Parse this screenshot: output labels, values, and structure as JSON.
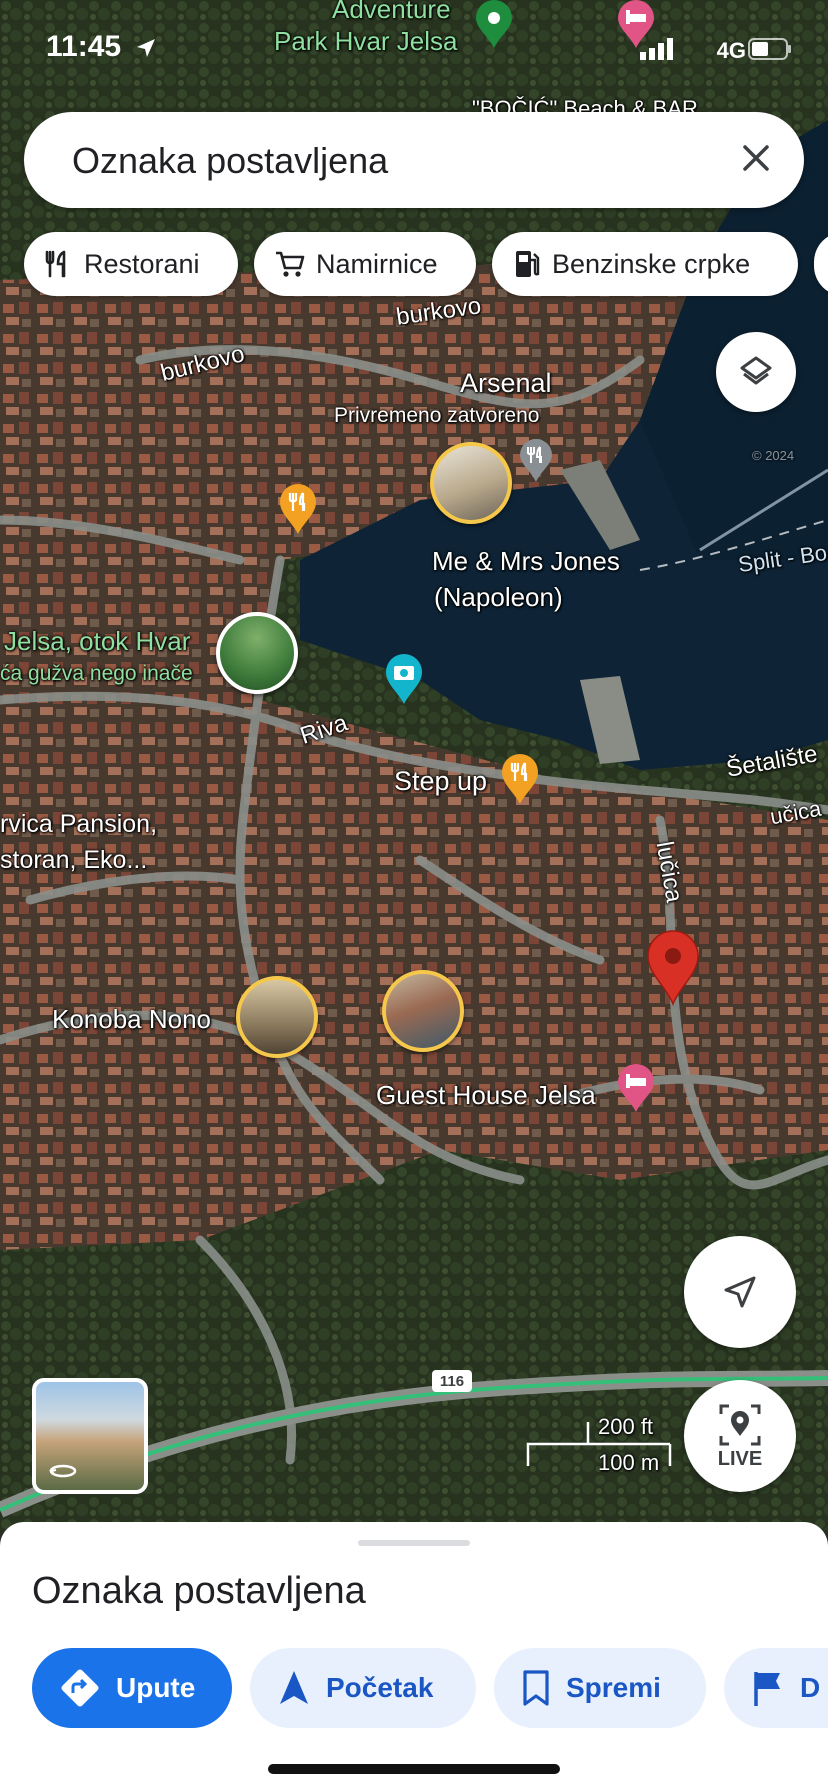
{
  "status_bar": {
    "time": "11:45",
    "network": "4G"
  },
  "search": {
    "query": "Oznaka postavljena"
  },
  "chips": [
    {
      "label": "Restorani",
      "icon": "restaurant-icon"
    },
    {
      "label": "Namirnice",
      "icon": "cart-icon"
    },
    {
      "label": "Benzinske crpke",
      "icon": "gas-station-icon"
    }
  ],
  "map": {
    "labels": {
      "adventure_top": "Adventure",
      "adventure_park": "Park Hvar Jelsa",
      "bocic": "\"BOČIĆ\" Beach & BAR",
      "burkovo_1": "burkovo",
      "burkovo_2": "burkovo",
      "arsenal": "Arsenal",
      "arsenal_status": "Privremeno zatvoreno",
      "me_mrs_jones_1": "Me & Mrs Jones",
      "me_mrs_jones_2": "(Napoleon)",
      "split_ferry": "Split - Bo",
      "jelsa_1": "Jelsa, otok Hvar",
      "jelsa_2": "ća gužva nego inače",
      "riva": "Riva",
      "step_up": "Step up",
      "setaliste": "Šetalište",
      "ucica_right": "učica",
      "ucica_street": "lučica",
      "pansion_1": "rvica Pansion,",
      "pansion_2": "storan, Eko...",
      "konoba_nono": "Konoba Nono",
      "guest_house": "Guest House Jelsa",
      "road_116": "116",
      "scale_ft": "200 ft",
      "scale_m": "100 m",
      "copyright": "© 2024"
    }
  },
  "buttons": {
    "live_label": "LIVE"
  },
  "sheet": {
    "title": "Oznaka postavljena",
    "actions": [
      {
        "label": "Upute",
        "icon": "directions-icon"
      },
      {
        "label": "Početak",
        "icon": "navigation-arrow-icon"
      },
      {
        "label": "Spremi",
        "icon": "bookmark-icon"
      },
      {
        "label": "D",
        "icon": "flag-icon"
      }
    ]
  },
  "colors": {
    "water": "#0e2436",
    "land": "#3a4330",
    "road": "#8a8f8a",
    "accent_blue": "#1a73e8",
    "pin_red": "#d93025",
    "food_orange": "#f2a122",
    "hotel_pink": "#e05585",
    "photo_teal": "#12b5cb",
    "park_green": "#1e8e3e",
    "highway_green": "#35c07a"
  }
}
